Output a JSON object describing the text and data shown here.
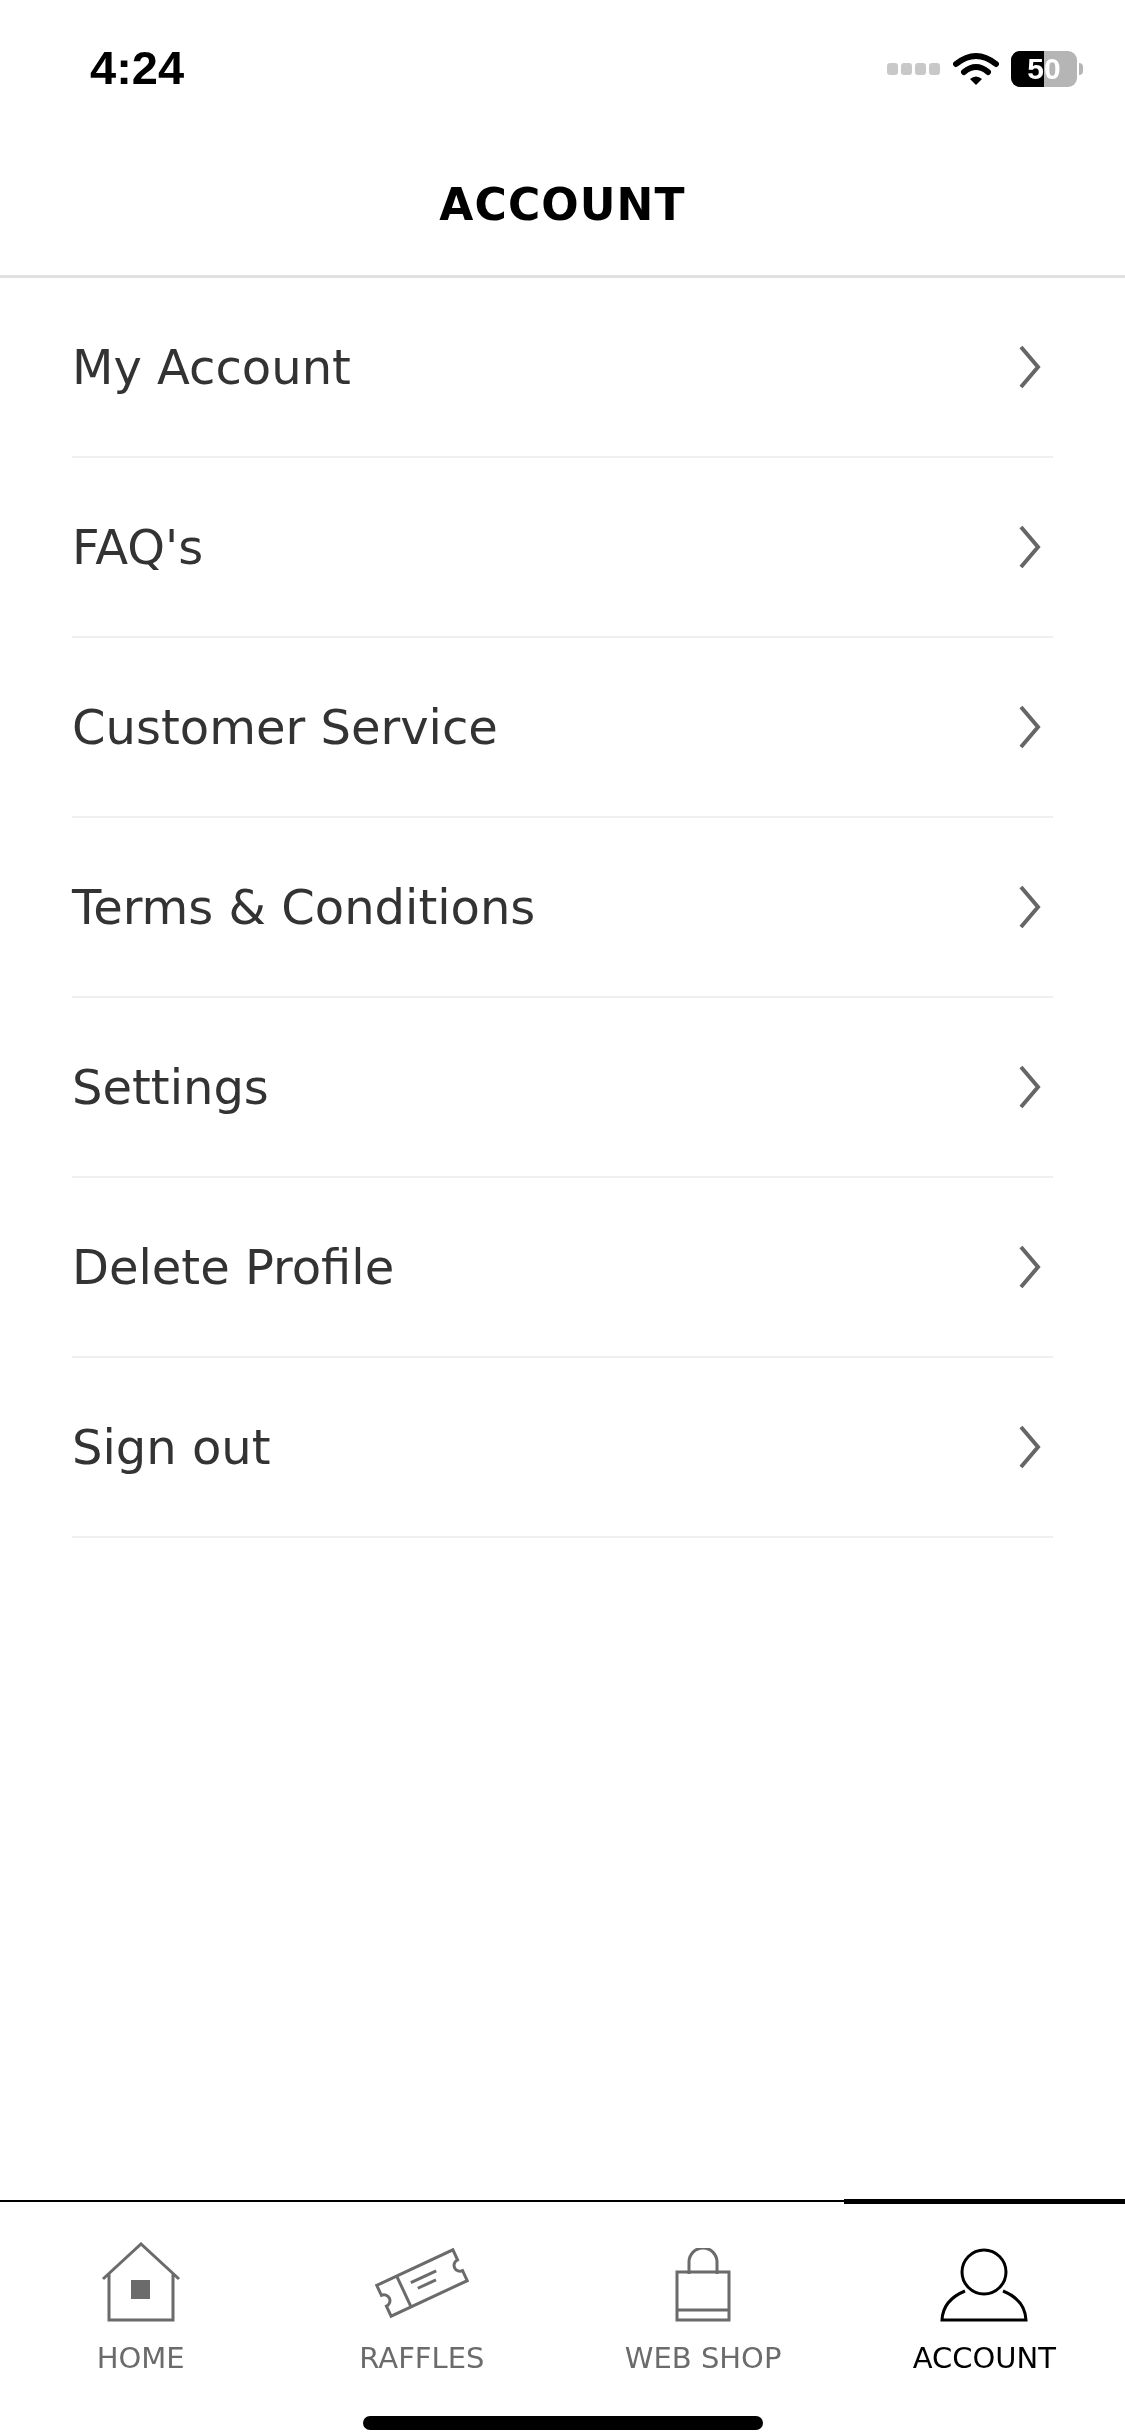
{
  "status_bar": {
    "time": "4:24",
    "battery": "50"
  },
  "header": {
    "title": "ACCOUNT"
  },
  "menu": [
    {
      "label": "My Account"
    },
    {
      "label": "FAQ's"
    },
    {
      "label": "Customer Service"
    },
    {
      "label": "Terms & Conditions"
    },
    {
      "label": "Settings"
    },
    {
      "label": "Delete Profile"
    },
    {
      "label": "Sign out"
    }
  ],
  "tab_bar": [
    {
      "label": "HOME",
      "kind": "home",
      "selected": false
    },
    {
      "label": "RAFFLES",
      "kind": "raffles",
      "selected": false
    },
    {
      "label": "WEB SHOP",
      "kind": "shop",
      "selected": false
    },
    {
      "label": "ACCOUNT",
      "kind": "account",
      "selected": true
    }
  ]
}
